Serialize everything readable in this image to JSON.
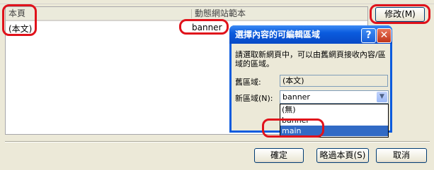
{
  "table": {
    "col_page": "本頁",
    "col_template": "動態網站範本",
    "rows": [
      {
        "page": "(本文)",
        "template": "banner"
      }
    ]
  },
  "buttons": {
    "modify": "修改(M)",
    "ok": "確定",
    "skip": "略過本頁(S)",
    "cancel": "取消"
  },
  "dialog": {
    "title": "選擇內容的可編輯區域",
    "help": "?",
    "close": "✕",
    "instruction": "請選取新網頁中，可以由舊網頁接收內容/區域的區域。",
    "old_label": "舊區域:",
    "old_value": "(本文)",
    "new_label": "新區域(N):",
    "new_value": "banner",
    "options": [
      "(無)",
      "banner",
      "main"
    ],
    "selected_option": "main"
  },
  "colors": {
    "highlight": "#316ac5",
    "annotation": "#e0121b"
  }
}
